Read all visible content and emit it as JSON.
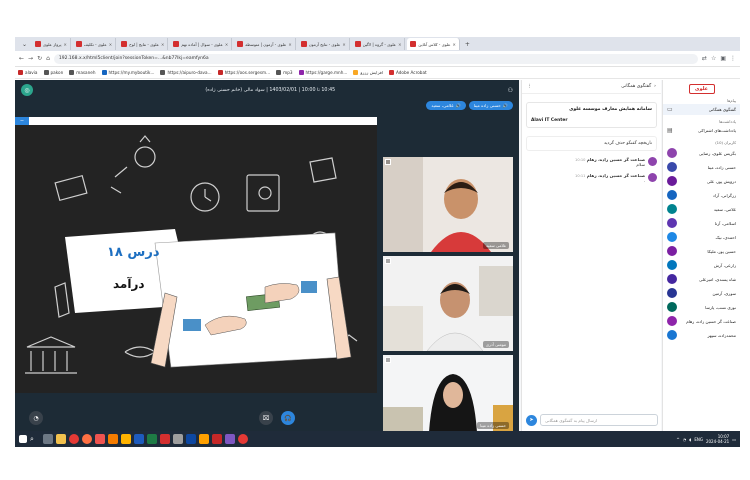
{
  "browser": {
    "tabs": [
      {
        "label": "پرواز علوی"
      },
      {
        "label": "علوی - تکلیف"
      },
      {
        "label": "علوی - نتایج | لوح"
      },
      {
        "label": "علوی - سوال | آماده نهم"
      },
      {
        "label": "علوی - آزمون | متوسطه"
      },
      {
        "label": "علوی - نتایج آزمون"
      },
      {
        "label": "علوی - گروه | لاگین"
      },
      {
        "label": "علوی - کلاس آنلاین"
      }
    ],
    "url": "192.168.x.x/html5client/join?sessionToken=...&nb77lkj=eamfyn6a",
    "bookmarks": [
      {
        "label": "alavia"
      },
      {
        "label": "pakon"
      },
      {
        "label": "masaneh"
      },
      {
        "label": "https://my.myboutik..."
      },
      {
        "label": "https://aipuro-dava..."
      },
      {
        "label": "https://oos.sergesm..."
      },
      {
        "label": "mp3"
      },
      {
        "label": "https://garge.mnh..."
      },
      {
        "label": "افزایش رزرو"
      },
      {
        "label": "Adobe Acrobat"
      }
    ]
  },
  "session": {
    "title": "10:45 تا 10:00 | 1403/02/01 | سواد مالی (خانم حسنی زاده)",
    "chips": [
      "حسنی زاده مینا",
      "غلامی، سعید"
    ]
  },
  "slide": {
    "lesson": "درس ۱۸",
    "topic": "درآمد"
  },
  "cameras": [
    {
      "label": "غلامی سعید"
    },
    {
      "label": "مومنی آذری"
    },
    {
      "label": "حسنی زاده مینا"
    }
  ],
  "chat": {
    "header": "گفتگوی همگانی",
    "pinned_title": "سامانه همایش معارف موسسه علوی",
    "pinned_brand": "Alavi IT Center",
    "system_message": "تاریخچه گفتگو حذف گردید",
    "messages": [
      {
        "author": "صناعت گر حسین زاده، رهام",
        "time": "10:10",
        "text": "سلام"
      },
      {
        "author": "صناعت گر حسین زاده، رهام",
        "time": "10:11",
        "text": "."
      }
    ],
    "input_placeholder": "ارسال پیام به گفتگوی همگانی"
  },
  "sidebar": {
    "brand": "علوی",
    "sec_messages": "پیام‌ها",
    "public_chat": "گفتگوی همگانی",
    "sec_notes": "یادداشت‌ها",
    "shared_notes": "یادداشت‌های اشتراکی",
    "sec_users": "کاربران (10)",
    "users": [
      {
        "name": "بگریس علوی، رضایی"
      },
      {
        "name": "حسنی زاده، مینا"
      },
      {
        "name": "درویش پور، علی"
      },
      {
        "name": "زرگرانی، آراد"
      },
      {
        "name": "غلامی، سعید"
      },
      {
        "name": "اسلامی، آرتا"
      },
      {
        "name": "احمدی، نیک"
      },
      {
        "name": "حسین پور، ملیکا"
      },
      {
        "name": "زارعی، آرش"
      },
      {
        "name": "شاه پسندی، امیرعلی"
      },
      {
        "name": "سوری، آرمین"
      },
      {
        "name": "نوری نسب، پارسا"
      },
      {
        "name": "صناعت گر حسین زاده، رهام"
      },
      {
        "name": "محمدزاده، سپهر"
      }
    ]
  },
  "taskbar": {
    "lang": "ENG",
    "time": "10:07",
    "date": "2024-04-21"
  }
}
